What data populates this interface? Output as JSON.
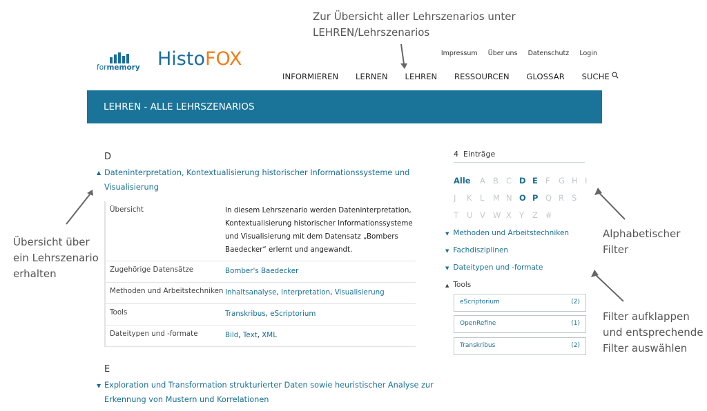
{
  "annotations": {
    "top_line1": "Zur Übersicht aller Lehrszenarios unter",
    "top_line2": "LEHREN/Lehrszenarios",
    "left_line1": "Übersicht über",
    "left_line2": "ein Lehrszenario",
    "left_line3": "erhalten",
    "right1_line1": "Alphabetischer",
    "right1_line2": "Filter",
    "right2_line1": "Filter aufklappen",
    "right2_line2": "und entsprechende",
    "right2_line3": "Filter auswählen"
  },
  "header": {
    "partner_logo_text_pre": "for",
    "partner_logo_text_bold": "memory",
    "brand_part1": "Histo",
    "brand_part2": "FOX",
    "top_links": [
      "Impressum",
      "Über uns",
      "Datenschutz",
      "Login"
    ],
    "nav": [
      "INFORMIEREN",
      "LERNEN",
      "LEHREN",
      "RESSOURCEN",
      "GLOSSAR",
      "SUCHE"
    ]
  },
  "banner": {
    "title": "LEHREN - ALLE LEHRSZENARIOS"
  },
  "main": {
    "groups": [
      {
        "letter": "D",
        "title_line1": "Dateninterpretation, Kontextualisierung historischer Informationssysteme und",
        "title_line2": "Visualisierung",
        "rows": [
          {
            "label": "Übersicht",
            "text_lines": [
              "In diesem Lehrszenario werden Dateninterpretation,",
              "Kontextualisierung historischer Informationssysteme",
              "und Visualisierung mit dem Datensatz „Bombers",
              "Baedecker“ erlernt und angewandt."
            ]
          },
          {
            "label": "Zugehörige Datensätze",
            "links": [
              "Bomber's Baedecker"
            ]
          },
          {
            "label": "Methoden und Arbeitstechniken",
            "links": [
              "Inhaltsanalyse",
              "Interpretation",
              "Visualisierung"
            ]
          },
          {
            "label": "Tools",
            "links": [
              "Transkribus",
              "eScriptorium"
            ]
          },
          {
            "label": "Dateitypen und -formate",
            "links": [
              "Bild",
              "Text",
              "XML"
            ]
          }
        ]
      },
      {
        "letter": "E",
        "title_line1": "Exploration und Transformation strukturierter Daten sowie heuristischer Analyse zur",
        "title_line2": "Erkennung von Mustern und Korrelationen"
      }
    ],
    "separator": ", "
  },
  "sidebar": {
    "count_label": "4  Einträge",
    "alpha_rows": [
      [
        "Alle",
        "A",
        "B",
        "C",
        "D",
        "E",
        "F",
        "G",
        "H",
        "I"
      ],
      [
        "J",
        "K",
        "L",
        "M",
        "N",
        "O",
        "P",
        "Q",
        "R",
        "S"
      ],
      [
        "T",
        "U",
        "V",
        "W",
        "X",
        "Y",
        "Z",
        "#"
      ]
    ],
    "alpha_active": [
      "Alle",
      "D",
      "E",
      "O",
      "P"
    ],
    "filters": [
      "Methoden und Arbeitstechniken",
      "Fachdisziplinen",
      "Dateitypen und -formate",
      "Tools"
    ],
    "tools": [
      {
        "name": "eScriptorium",
        "count": "(2)"
      },
      {
        "name": "OpenRefine",
        "count": "(1)"
      },
      {
        "name": "Transkribus",
        "count": "(2)"
      }
    ]
  },
  "colors": {
    "accent": "#1a7398",
    "link": "#1a6f95",
    "brand_blue": "#1b6da0",
    "brand_orange": "#f07d1a"
  }
}
